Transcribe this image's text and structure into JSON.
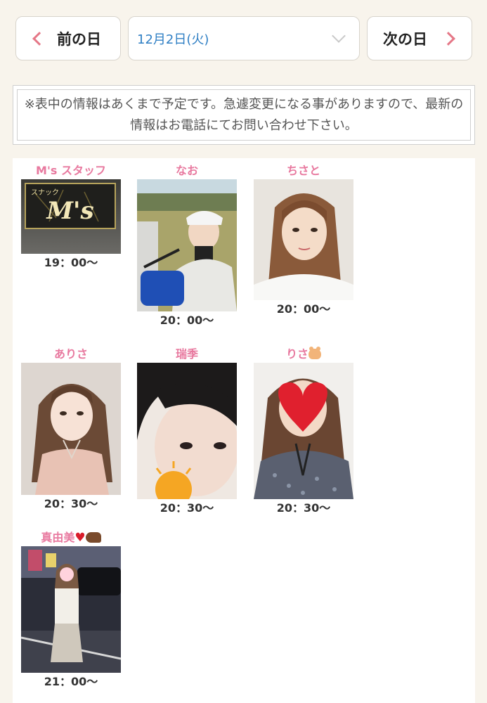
{
  "nav": {
    "prev_label": "前の日",
    "next_label": "次の日",
    "date_selected": "12月2日(火)"
  },
  "notice": "※表中の情報はあくまで予定です。急遽変更になる事がありますので、最新の情報はお電話にてお問い合わせ下さい。",
  "cast": [
    {
      "name": "M's スタッフ",
      "time": "19：00〜"
    },
    {
      "name": "なお",
      "time": "20：00〜"
    },
    {
      "name": "ちさと",
      "time": "20：00〜"
    },
    {
      "name": "ありさ",
      "time": "20：30〜"
    },
    {
      "name": "瑞季",
      "time": "20：30〜"
    },
    {
      "name": "りさ",
      "time": "20：30〜"
    },
    {
      "name": "真由美",
      "time": "21：00〜"
    }
  ],
  "photo_texts": {
    "staff_sign_small": "スナック",
    "staff_sign_big": "M's"
  },
  "colors": {
    "accent_pink": "#e8799f",
    "chevron_pink": "#e57787",
    "date_blue": "#2f7fc4",
    "background": "#f8f4ec"
  },
  "icons": [
    "chevron-left-icon",
    "chevron-right-icon",
    "chevron-down-icon",
    "hamster-emoji",
    "heart-emoji",
    "beaver-emoji"
  ]
}
